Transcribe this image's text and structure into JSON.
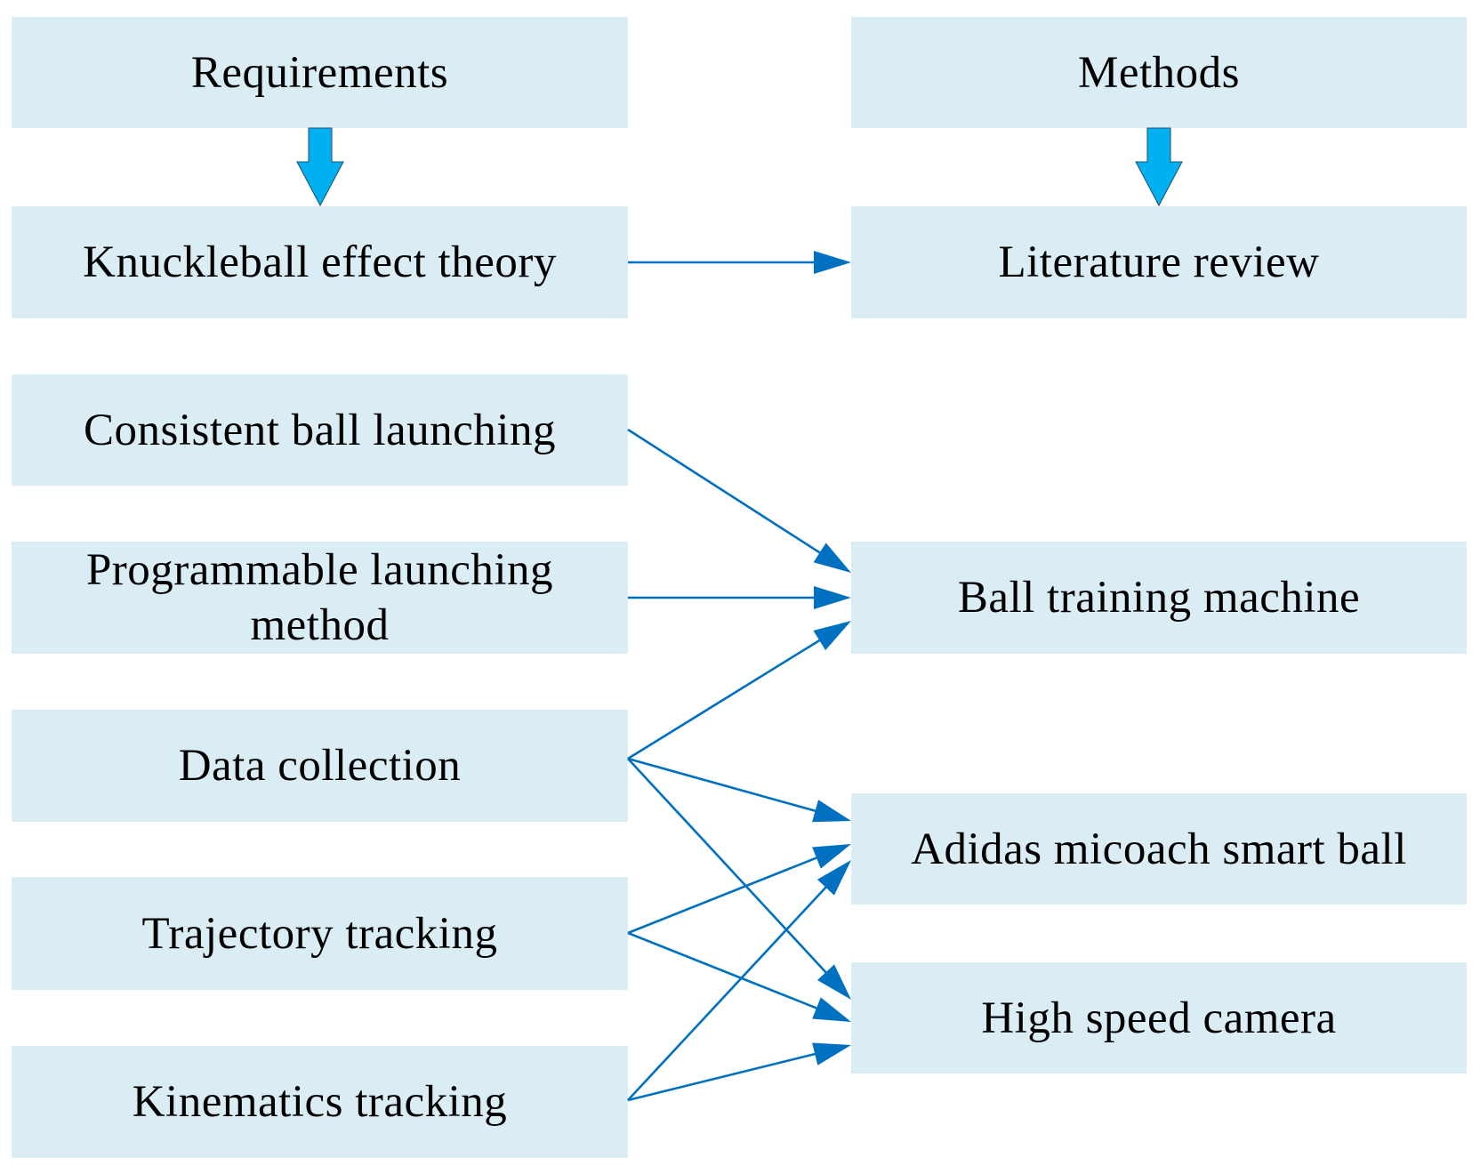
{
  "diagram": {
    "colors": {
      "box_fill": "#daedf4",
      "connector": "#0070c0",
      "block_arrow_fill": "#00b0f0",
      "block_arrow_stroke": "#1f4e6b"
    },
    "headers": {
      "requirements": "Requirements",
      "methods": "Methods"
    },
    "requirements": [
      {
        "id": "knuckleball",
        "label": "Knuckleball effect theory"
      },
      {
        "id": "consistent",
        "label": "Consistent ball launching"
      },
      {
        "id": "programmable",
        "label": "Programmable launching method"
      },
      {
        "id": "data",
        "label": "Data collection"
      },
      {
        "id": "trajectory",
        "label": "Trajectory tracking"
      },
      {
        "id": "kinematics",
        "label": "Kinematics tracking"
      }
    ],
    "methods": [
      {
        "id": "literature",
        "label": "Literature review"
      },
      {
        "id": "machine",
        "label": "Ball training machine"
      },
      {
        "id": "smartball",
        "label": "Adidas micoach smart ball"
      },
      {
        "id": "camera",
        "label": "High speed camera"
      }
    ],
    "block_arrows": [
      {
        "from": "requirements",
        "to": "knuckleball"
      },
      {
        "from": "methods",
        "to": "literature"
      }
    ],
    "edges": [
      {
        "from": "knuckleball",
        "to": "literature"
      },
      {
        "from": "consistent",
        "to": "machine"
      },
      {
        "from": "programmable",
        "to": "machine"
      },
      {
        "from": "data",
        "to": "machine"
      },
      {
        "from": "data",
        "to": "smartball"
      },
      {
        "from": "data",
        "to": "camera"
      },
      {
        "from": "trajectory",
        "to": "smartball"
      },
      {
        "from": "trajectory",
        "to": "camera"
      },
      {
        "from": "kinematics",
        "to": "smartball"
      },
      {
        "from": "kinematics",
        "to": "camera"
      }
    ]
  }
}
